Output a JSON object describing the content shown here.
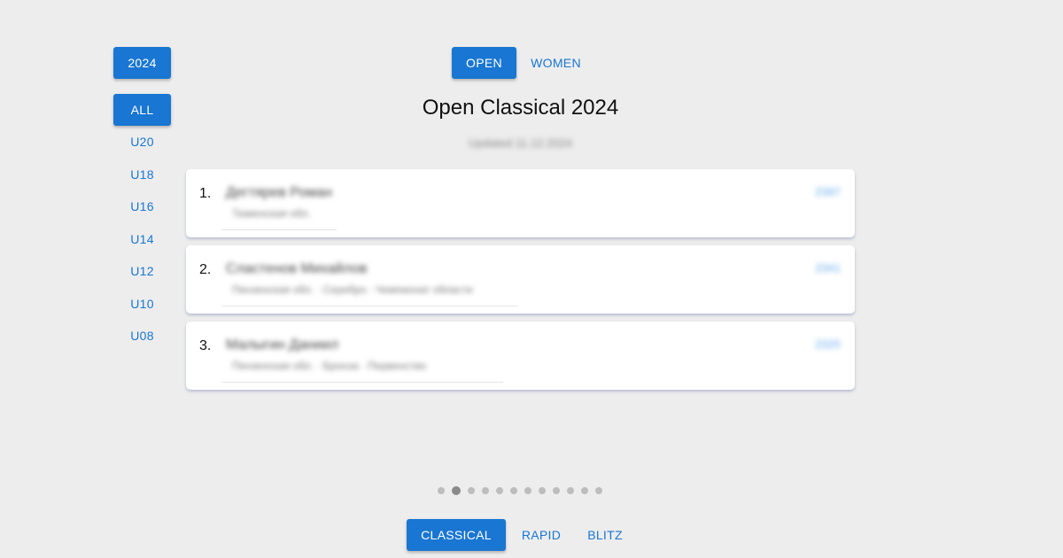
{
  "year_button": "2024",
  "categories": [
    "ALL",
    "U20",
    "U18",
    "U16",
    "U14",
    "U12",
    "U10",
    "U08"
  ],
  "sections": {
    "open": "OPEN",
    "women": "WOMEN"
  },
  "title": "Open Classical 2024",
  "subtitle": "Updated 11.12.2024",
  "standings": [
    {
      "rank": "1.",
      "name": "Дегтярев Роман",
      "meta": "Тюменская обл.",
      "rating": "2397"
    },
    {
      "rank": "2.",
      "name": "Сластенов Михайлов",
      "meta": "Пензенская обл. · Серебро · Чемпионат области",
      "rating": "2341"
    },
    {
      "rank": "3.",
      "name": "Малыгин Даниил",
      "meta": "Пензенская обл. · Бронза · Первенство",
      "rating": "2325"
    }
  ],
  "pagination": {
    "total": 12,
    "active_index": 1
  },
  "time_controls": {
    "classical": "CLASSICAL",
    "rapid": "RAPID",
    "blitz": "BLITZ"
  },
  "colors": {
    "accent": "#1976d2",
    "background": "#ededed"
  }
}
